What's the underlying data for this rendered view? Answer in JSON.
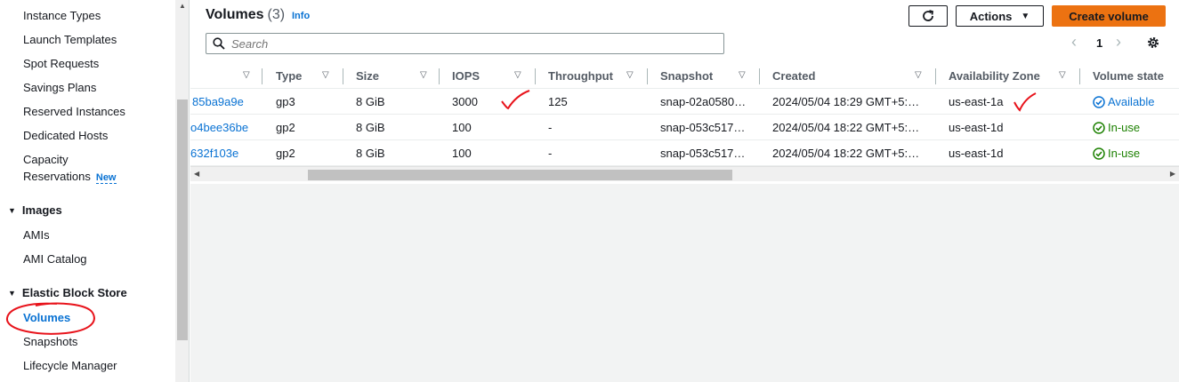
{
  "sidebar": {
    "items": [
      {
        "label": "Instance Types"
      },
      {
        "label": "Launch Templates"
      },
      {
        "label": "Spot Requests"
      },
      {
        "label": "Savings Plans"
      },
      {
        "label": "Reserved Instances"
      },
      {
        "label": "Dedicated Hosts"
      },
      {
        "label": "Capacity"
      },
      {
        "label": "Reservations"
      }
    ],
    "new_badge": "New",
    "images_group": "Images",
    "images_items": [
      {
        "label": "AMIs"
      },
      {
        "label": "AMI Catalog"
      }
    ],
    "ebs_group": "Elastic Block Store",
    "ebs_items": [
      {
        "label": "Volumes"
      },
      {
        "label": "Snapshots"
      },
      {
        "label": "Lifecycle Manager"
      }
    ]
  },
  "header": {
    "title": "Volumes",
    "count": "(3)",
    "info": "Info",
    "actions_label": "Actions",
    "create_label": "Create volume"
  },
  "search": {
    "placeholder": "Search"
  },
  "pagination": {
    "page": "1"
  },
  "table": {
    "columns": [
      "Type",
      "Size",
      "IOPS",
      "Throughput",
      "Snapshot",
      "Created",
      "Availability Zone",
      "Volume state"
    ],
    "rows": [
      {
        "volume_id": "85ba9a9e",
        "type": "gp3",
        "size": "8 GiB",
        "iops": "3000",
        "throughput": "125",
        "snapshot": "snap-02a0580…",
        "created": "2024/05/04 18:29 GMT+5:…",
        "az": "us-east-1a",
        "state": "Available"
      },
      {
        "volume_id": "o4bee36be",
        "type": "gp2",
        "size": "8 GiB",
        "iops": "100",
        "throughput": "-",
        "snapshot": "snap-053c517…",
        "created": "2024/05/04 18:22 GMT+5:…",
        "az": "us-east-1d",
        "state": "In-use"
      },
      {
        "volume_id": "632f103e",
        "type": "gp2",
        "size": "8 GiB",
        "iops": "100",
        "throughput": "-",
        "snapshot": "snap-053c517…",
        "created": "2024/05/04 18:22 GMT+5:…",
        "az": "us-east-1d",
        "state": "In-use"
      }
    ]
  },
  "colors": {
    "accent": "#0972d3",
    "primary_button": "#ec7211",
    "available": "#0972d3",
    "in_use": "#1d8102",
    "annotation": "#e8141c"
  }
}
